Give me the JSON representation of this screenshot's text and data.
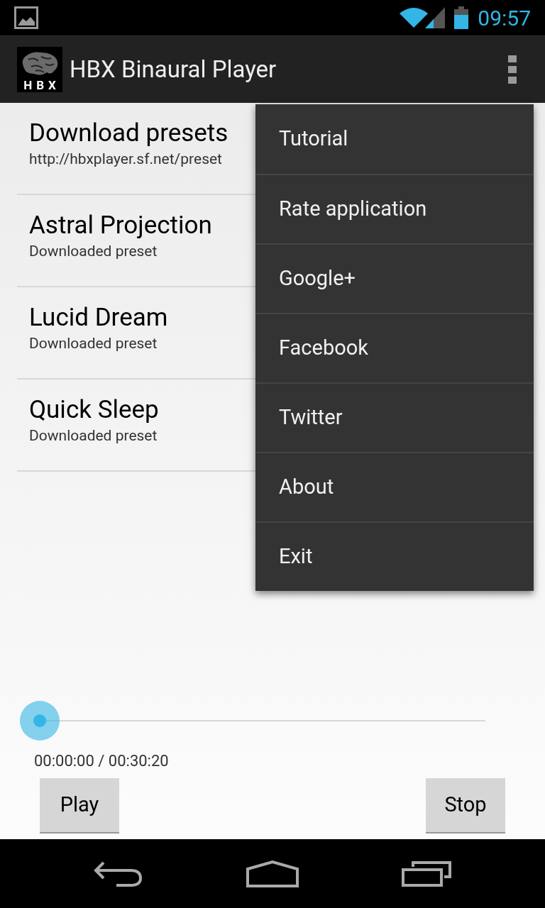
{
  "status_bar": {
    "time": "09:57"
  },
  "action_bar": {
    "logo_text": "HBX",
    "title": "HBX Binaural Player"
  },
  "presets": [
    {
      "title": "Download presets",
      "subtitle": "http://hbxplayer.sf.net/preset"
    },
    {
      "title": "Astral Projection",
      "subtitle": "Downloaded preset"
    },
    {
      "title": "Lucid Dream",
      "subtitle": "Downloaded preset"
    },
    {
      "title": "Quick Sleep",
      "subtitle": "Downloaded preset"
    }
  ],
  "player": {
    "time": "00:00:00 / 00:30:20",
    "buttons": [
      "Play",
      "Stop"
    ]
  },
  "overflow_menu": [
    "Tutorial",
    "Rate application",
    "Google+",
    "Facebook",
    "Twitter",
    "About",
    "Exit"
  ]
}
